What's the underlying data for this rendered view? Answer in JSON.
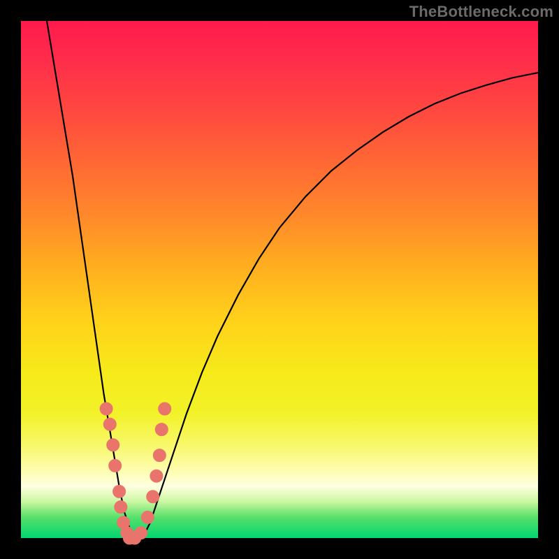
{
  "watermark": "TheBottleneck.com",
  "colors": {
    "gradient_top": "#ff1a4d",
    "gradient_mid": "#ffd21a",
    "gradient_bottom": "#00d670",
    "curve": "#000000",
    "dots": "#e9746c",
    "frame": "#000000"
  },
  "chart_data": {
    "type": "line",
    "title": "",
    "xlabel": "",
    "ylabel": "",
    "xlim": [
      0,
      100
    ],
    "ylim": [
      0,
      100
    ],
    "grid": false,
    "series": [
      {
        "name": "bottleneck-curve",
        "x": [
          5,
          6,
          7,
          8,
          9,
          10,
          11,
          12,
          13,
          14,
          15,
          16,
          17,
          18,
          19,
          20,
          21,
          22,
          23,
          24,
          25,
          26,
          28,
          30,
          32,
          35,
          38,
          42,
          46,
          50,
          55,
          60,
          65,
          70,
          75,
          80,
          85,
          90,
          95,
          100
        ],
        "y": [
          100,
          94,
          88,
          82,
          76,
          70,
          63,
          56,
          49,
          42,
          35,
          28,
          22,
          16,
          10,
          5,
          2,
          0,
          0,
          1,
          3,
          6,
          12,
          18,
          24,
          32,
          39,
          47,
          54,
          60,
          66,
          71,
          75,
          78.5,
          81.5,
          84,
          86,
          87.6,
          89,
          90
        ]
      }
    ],
    "scatter_points": {
      "name": "highlighted-points",
      "x": [
        16.5,
        17.2,
        17.8,
        18.2,
        19.0,
        19.3,
        19.8,
        20.5,
        21.0,
        22.0,
        23.2,
        24.5,
        25.5,
        26.2,
        26.8,
        27.2,
        27.8
      ],
      "y": [
        25,
        22,
        18,
        14,
        9,
        6,
        3,
        1,
        0,
        0,
        1,
        4,
        8,
        12,
        16,
        21,
        25
      ]
    }
  }
}
